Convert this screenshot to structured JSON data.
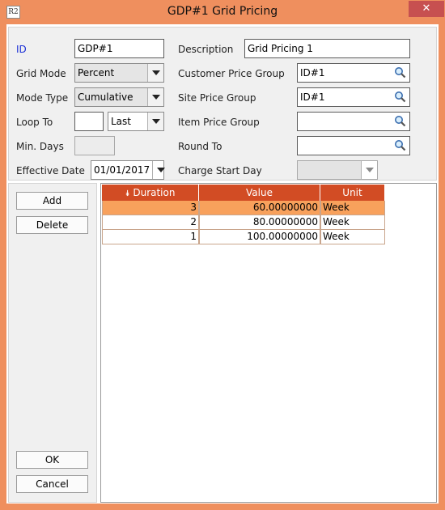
{
  "window": {
    "title": "GDP#1 Grid Pricing",
    "app_icon_text": "R2",
    "close_glyph": "✕"
  },
  "form": {
    "id": {
      "label": "ID",
      "value": "GDP#1"
    },
    "description": {
      "label": "Description",
      "value": "Grid Pricing 1"
    },
    "grid_mode": {
      "label": "Grid Mode",
      "value": "Percent"
    },
    "customer_price_group": {
      "label": "Customer Price Group",
      "value": "ID#1"
    },
    "mode_type": {
      "label": "Mode Type",
      "value": "Cumulative"
    },
    "site_price_group": {
      "label": "Site Price Group",
      "value": "ID#1"
    },
    "loop_to": {
      "label": "Loop To",
      "value": "",
      "select_value": "Last"
    },
    "item_price_group": {
      "label": "Item Price Group",
      "value": ""
    },
    "min_days": {
      "label": "Min. Days",
      "value": ""
    },
    "round_to": {
      "label": "Round To",
      "value": ""
    },
    "effective_date": {
      "label": "Effective Date",
      "value": "01/01/2017"
    },
    "charge_start_day": {
      "label": "Charge Start Day",
      "value": ""
    }
  },
  "buttons": {
    "add": "Add",
    "delete": "Delete",
    "ok": "OK",
    "cancel": "Cancel"
  },
  "grid": {
    "sort_glyph": "⯯",
    "columns": [
      "Duration",
      "Value",
      "Unit"
    ],
    "rows": [
      {
        "duration": "3",
        "value": "60.00000000",
        "unit": "Week",
        "selected": true
      },
      {
        "duration": "2",
        "value": "80.00000000",
        "unit": "Week",
        "selected": false
      },
      {
        "duration": "1",
        "value": "100.00000000",
        "unit": "Week",
        "selected": false
      }
    ]
  },
  "colors": {
    "frame": "#ef8f5e",
    "header": "#d24c24",
    "selected_row": "#f8a15c",
    "close_button": "#c75050",
    "id_label": "#1a2fd6"
  },
  "icons": {
    "lookup": "magnifier-icon",
    "dropdown": "chevron-down-icon",
    "sort": "sort-double-down-icon"
  }
}
